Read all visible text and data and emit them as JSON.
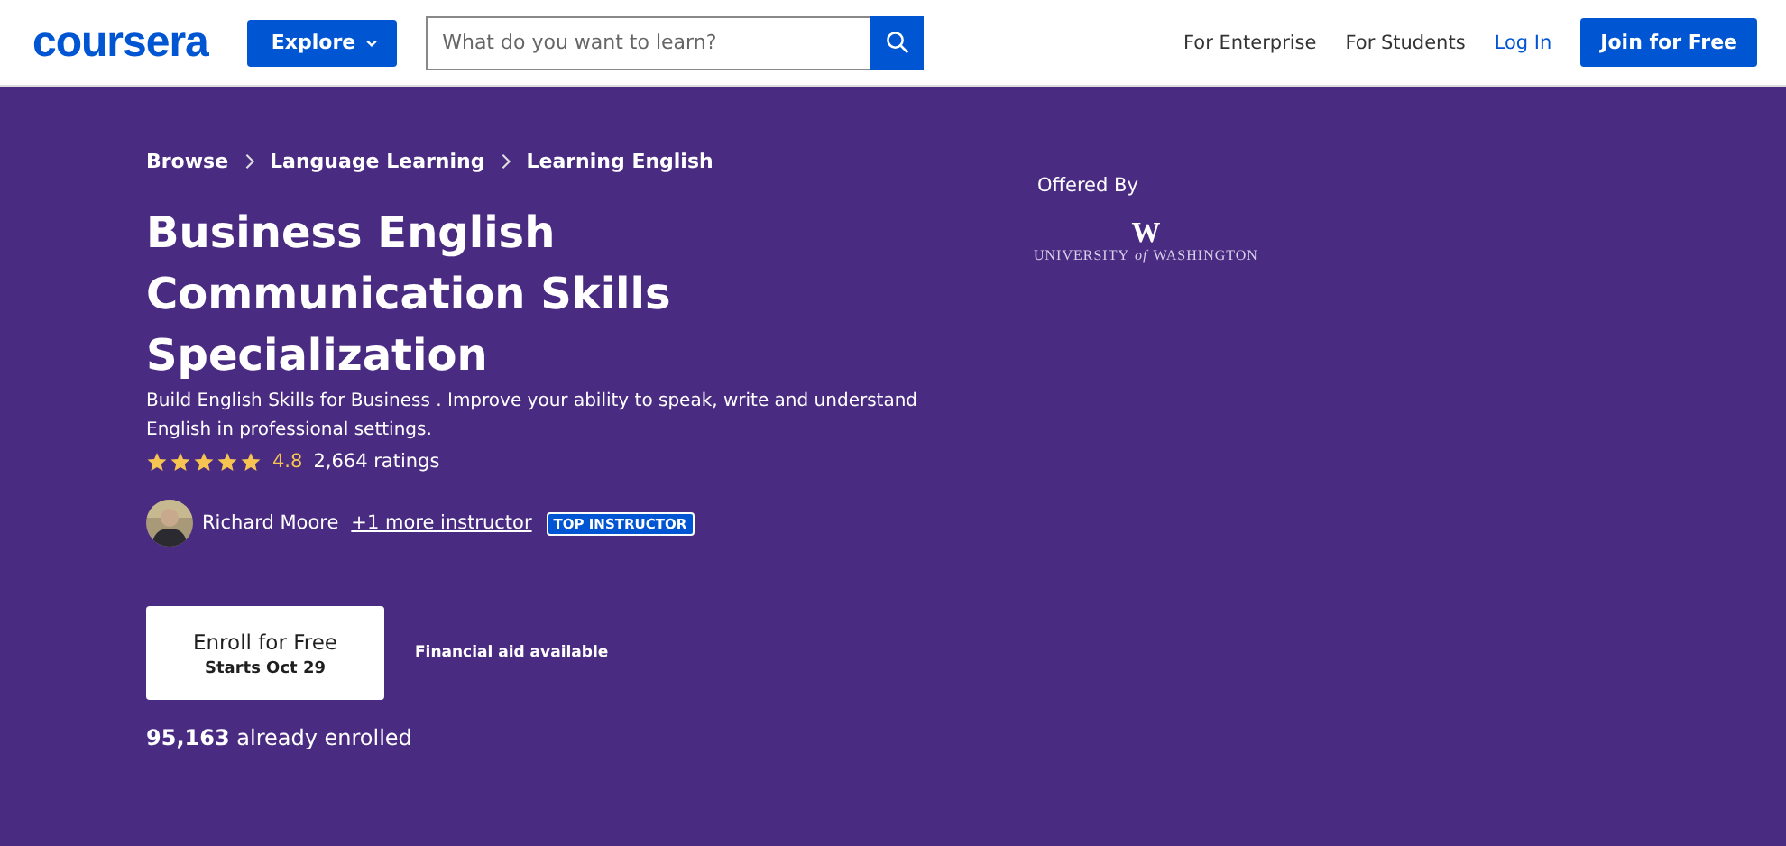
{
  "header": {
    "logo": "coursera",
    "explore": "Explore",
    "search": {
      "placeholder": "What do you want to learn?"
    },
    "nav": [
      {
        "label": "For Enterprise",
        "kind": "plain"
      },
      {
        "label": "For Students",
        "kind": "plain"
      },
      {
        "label": "Log In",
        "kind": "link"
      },
      {
        "label": "Join for Free",
        "kind": "button"
      }
    ]
  },
  "breadcrumbs": [
    "Browse",
    "Language Learning",
    "Learning English"
  ],
  "title": "Business English Communication Skills Specialization",
  "description": "Build English Skills for Business . Improve your ability to speak, write and understand English in professional settings.",
  "rating": {
    "stars": 5,
    "score": "4.8",
    "count": "2,664 ratings"
  },
  "instructor": {
    "name": "Richard Moore",
    "more": "+1 more instructor",
    "badge": "TOP INSTRUCTOR"
  },
  "enroll": {
    "label": "Enroll for Free",
    "sub": "Starts Oct 29"
  },
  "financial_aid": "Financial aid available",
  "enrolled": "**95,163** already enrolled",
  "offered_by": {
    "label": "Offered By",
    "mark": "W",
    "university": "UNIVERSITY",
    "of": "of",
    "place": "WASHINGTON"
  }
}
